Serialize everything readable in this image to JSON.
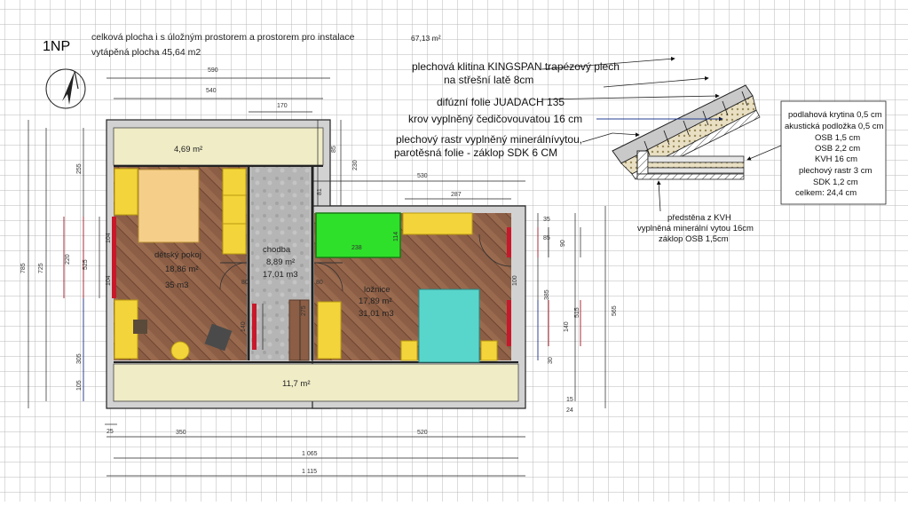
{
  "header": {
    "floor": "1NP",
    "total_area_label": "celková plocha i s úložným prostorem a prostorem pro instalace",
    "total_area_value": "67,13 m²",
    "heated_area": "vytápěná plocha 45,64 m2"
  },
  "notes": {
    "roof": [
      "plechová klitina KINGSPAN trapézový plech",
      "na střešní latě 8cm",
      "difúzní folie JUADACH 135",
      "krov vyplněný čedičovouvatou 16 cm",
      "plechový rastr vyplněný minerálnívytou,",
      "parotěsná folie - záklop SDK 6 CM"
    ],
    "floor_layers": [
      "podlahová krytina 0,5 cm",
      "akustická podložka 0,5 cm",
      "OSB 1,5 cm",
      "OSB 2,2 cm",
      "KVH  16 cm",
      "plechový rastr 3 cm",
      "SDK 1,2 cm",
      "celkem:  24,4 cm"
    ],
    "wall": [
      "předstěna z KVH",
      "vyplněná minerální vytou 16cm",
      "záklop OSB 1,5cm"
    ]
  },
  "rooms": {
    "storage_top": "4,69 m²",
    "child_name": "dětský pokoj",
    "child_area": "18,86 m²",
    "child_volume": "35 m3",
    "hall_name": "chodba",
    "hall_area": "8,89 m²",
    "hall_volume": "17,01 m3",
    "bedroom_name": "ložnice",
    "bedroom_area": "17,89 m²",
    "bedroom_volume": "31,01 m3",
    "storage_bottom": "11,7 m²",
    "wardrobe": "238"
  },
  "dimensions": {
    "d590": "590",
    "d540": "540",
    "d170": "170",
    "d530": "530",
    "d287": "287",
    "d350": "350",
    "d520": "520",
    "d1065": "1 065",
    "d1115": "1 115",
    "d785": "785",
    "d725": "725",
    "d565": "565",
    "d515": "515",
    "d385": "385",
    "d255": "255",
    "d220": "220",
    "d525": "525",
    "d305": "305",
    "d105": "105",
    "d104a": "104",
    "d104b": "104",
    "d230": "230",
    "d85": "85",
    "d81": "81",
    "d114": "114",
    "d100": "100",
    "d90": "90",
    "d140a": "140",
    "d140b": "140",
    "d275": "275",
    "d80a": "80",
    "d80b": "80",
    "d35": "35",
    "d85b": "85",
    "d24": "24",
    "d25": "25",
    "d15": "15",
    "d30": "30"
  },
  "colors": {
    "wall": "#d2d2d2",
    "storage": "#efecc6",
    "floor_wood": "#8b5e45",
    "hall_floor": "#b5b5b5",
    "cabinet": "#f3d43a",
    "bed_child": "#f5cf8a",
    "bed_master": "#58d6cc",
    "wardrobe": "#2ee02a",
    "heater": "#c8192a"
  }
}
